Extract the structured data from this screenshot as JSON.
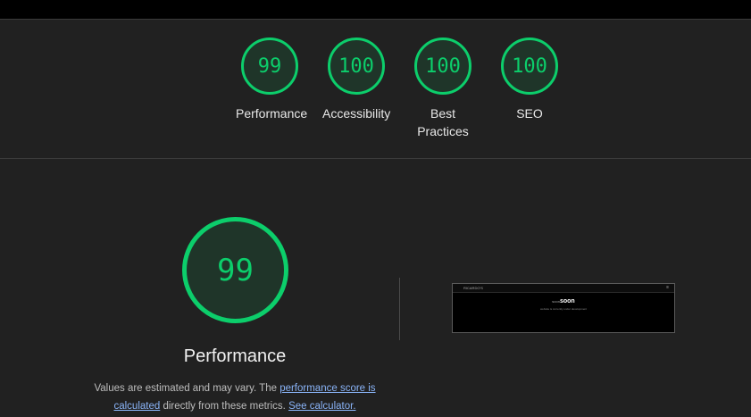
{
  "summary": {
    "categories": [
      {
        "score": "99",
        "label": "Performance"
      },
      {
        "score": "100",
        "label": "Accessibility"
      },
      {
        "score": "100",
        "label": "Best Practices"
      },
      {
        "score": "100",
        "label": "SEO"
      }
    ]
  },
  "performance": {
    "score": "99",
    "label": "Performance",
    "description_prefix": "Values are estimated and may vary. The ",
    "link_score": "performance score is calculated",
    "description_middle": " directly from these metrics. ",
    "link_calculator": "See calculator."
  },
  "screenshot": {
    "brand": "RICARDO'S",
    "menu": "≡",
    "title_pre": "soon",
    "title": "soon",
    "subtitle": "website is currently under development"
  },
  "colors": {
    "pass": "#0cce6b",
    "gauge_fill": "#1f3529",
    "background": "#212121",
    "link": "#8ab4f8"
  },
  "icons": {
    "thumbnail_menu": "hamburger-icon"
  }
}
